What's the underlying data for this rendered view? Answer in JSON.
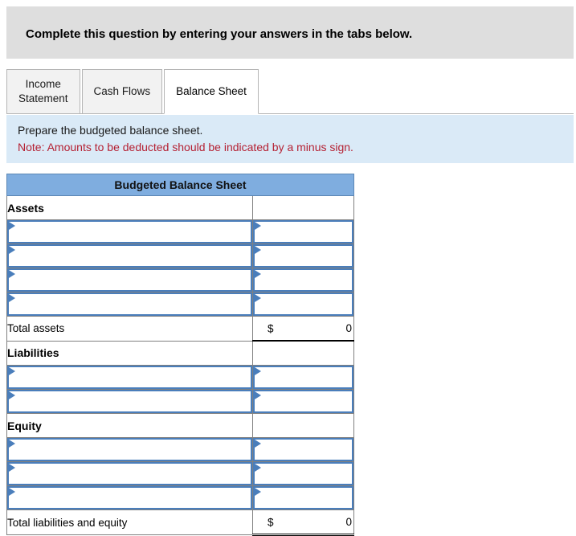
{
  "banner": {
    "text": "Complete this question by entering your answers in the tabs below."
  },
  "tabs": [
    {
      "label": "Income\nStatement",
      "name": "tab-income-statement",
      "active": false
    },
    {
      "label": "Cash Flows",
      "name": "tab-cash-flows",
      "active": false
    },
    {
      "label": "Balance Sheet",
      "name": "tab-balance-sheet",
      "active": true
    }
  ],
  "requirement": {
    "prompt": "Prepare the budgeted balance sheet.",
    "note": "Note: Amounts to be deducted should be indicated by a minus sign."
  },
  "table": {
    "title": "Budgeted Balance Sheet",
    "sections": [
      {
        "heading": "Assets",
        "input_rows": 4,
        "total_label": "Total assets",
        "total_currency": "$",
        "total_amount": "0",
        "total_style": "sub-total"
      },
      {
        "heading": "Liabilities",
        "input_rows": 2,
        "total_label": "",
        "total_currency": "",
        "total_amount": "",
        "total_style": ""
      },
      {
        "heading": "Equity",
        "input_rows": 3,
        "total_label": "Total liabilities and equity",
        "total_currency": "$",
        "total_amount": "0",
        "total_style": "grand-total"
      }
    ],
    "input_placeholder": ""
  },
  "colors": {
    "banner_bg": "#dedede",
    "panel_bg": "#daeaf7",
    "table_header_bg": "#7faddf",
    "note_text": "#b52133",
    "input_border": "#4a7ebb"
  }
}
